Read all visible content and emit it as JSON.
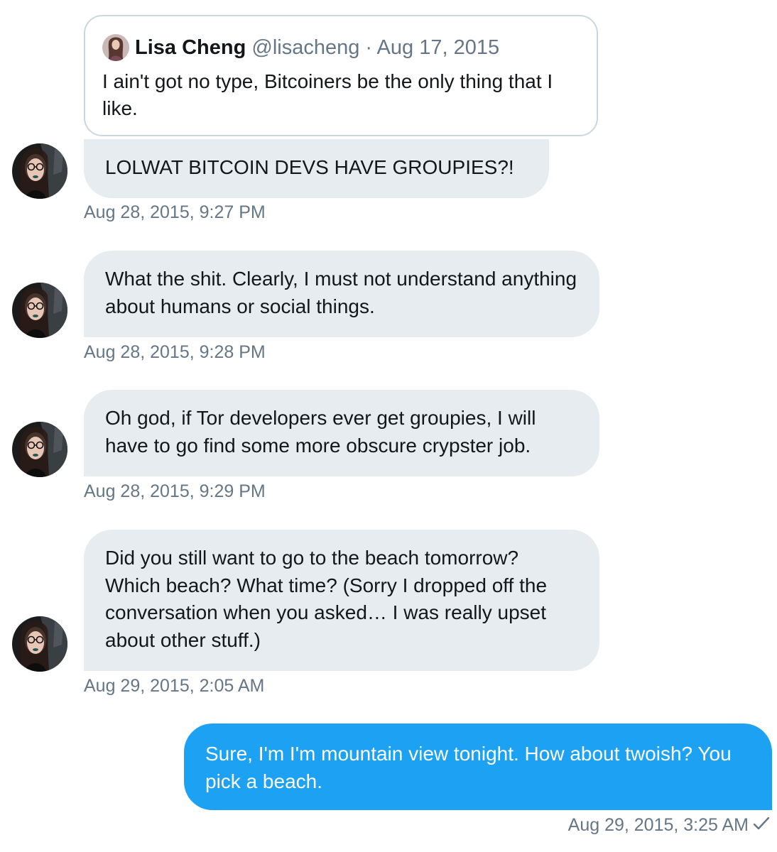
{
  "quoted_tweet": {
    "author_name": "Lisa Cheng",
    "author_handle": "@lisacheng",
    "separator": "·",
    "date": "Aug 17, 2015",
    "text": "I ain't got no type, Bitcoiners be the only thing that I like."
  },
  "messages": [
    {
      "direction": "incoming",
      "text": "LOLWAT BITCOIN DEVS HAVE GROUPIES?!",
      "timestamp": "Aug 28, 2015, 9:27 PM"
    },
    {
      "direction": "incoming",
      "text": "What the shit. Clearly, I must not understand anything about humans or social things.",
      "timestamp": "Aug 28, 2015, 9:28 PM"
    },
    {
      "direction": "incoming",
      "text": "Oh god, if Tor developers ever get groupies, I will have to go find some more obscure crypster job.",
      "timestamp": "Aug 28, 2015, 9:29 PM"
    },
    {
      "direction": "incoming",
      "text": "Did you still want to go to the beach tomorrow? Which beach? What time? (Sorry I dropped off the conversation when you asked… I was really upset about other stuff.)",
      "timestamp": "Aug 29, 2015, 2:05 AM"
    },
    {
      "direction": "outgoing",
      "text": "Sure, I'm I'm mountain view tonight. How about twoish? You pick a beach.",
      "timestamp": "Aug 29, 2015, 3:25 AM",
      "status_icon": "checkmark-icon"
    }
  ],
  "colors": {
    "incoming_bubble": "#e6ecf0",
    "outgoing_bubble": "#1da1f2",
    "muted_text": "#657786",
    "border": "#ccd6dd"
  }
}
